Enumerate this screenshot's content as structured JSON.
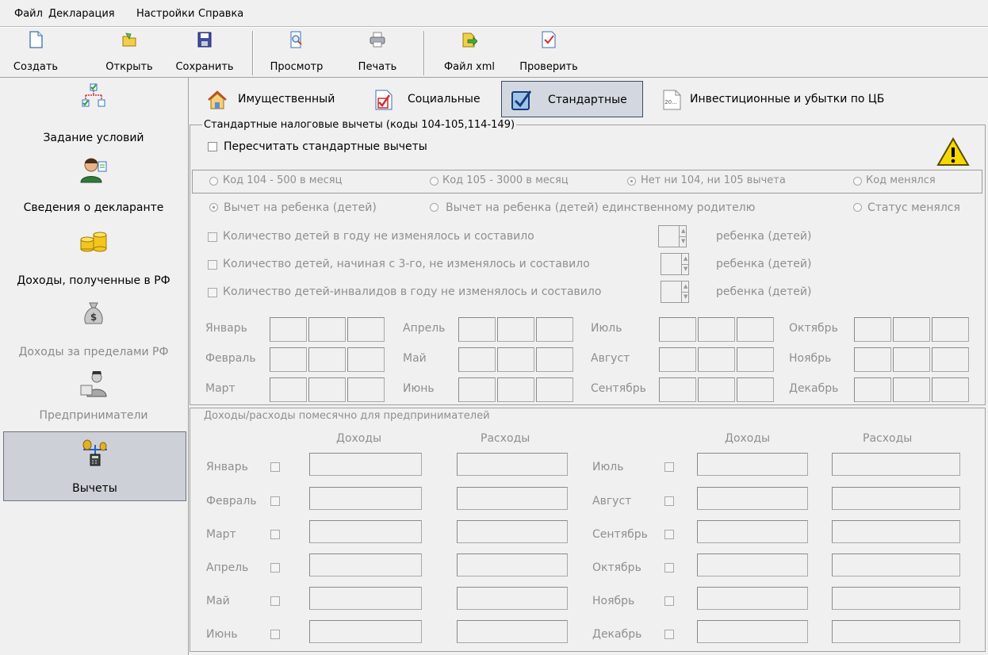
{
  "menu": [
    "Файл",
    "Декларация",
    "Настройки",
    "Справка"
  ],
  "toolbar": {
    "create": "Создать",
    "open": "Открыть",
    "save": "Сохранить",
    "preview": "Просмотр",
    "print": "Печать",
    "xml": "Файл xml",
    "check": "Проверить"
  },
  "sidebar": [
    {
      "label": "Задание условий",
      "icon": "conditions-icon",
      "state": "normal"
    },
    {
      "label": "Сведения о декларанте",
      "icon": "person-icon",
      "state": "normal"
    },
    {
      "label": "Доходы, полученные в РФ",
      "icon": "coins-icon",
      "state": "normal"
    },
    {
      "label": "Доходы за пределами РФ",
      "icon": "money-bag-icon",
      "state": "disabled"
    },
    {
      "label": "Предприниматели",
      "icon": "businessman-icon",
      "state": "disabled"
    },
    {
      "label": "Вычеты",
      "icon": "calculator-icon",
      "state": "selected"
    }
  ],
  "tabs": [
    {
      "label": "Имущественный",
      "icon": "house-icon"
    },
    {
      "label": "Социальные",
      "icon": "checked-doc-icon"
    },
    {
      "label": "Стандартные",
      "icon": "checkbox-icon",
      "active": true
    },
    {
      "label": "Инвестиционные и убытки по ЦБ",
      "icon": "doc-20-icon",
      "icon_text": "20..."
    }
  ],
  "standard": {
    "title": "Стандартные налоговые вычеты (коды 104-105,114-149)",
    "recalc": "Пересчитать стандартные вычеты",
    "codes": {
      "code104": "Код 104 - 500 в месяц",
      "code105": "Код 105 - 3000 в месяц",
      "none": "Нет ни 104, ни 105 вычета",
      "changed": "Код менялся",
      "selected": "none"
    },
    "child": {
      "child": "Вычет на ребенка (детей)",
      "single_parent": "Вычет на ребенка (детей) единственному родителю",
      "status": "Статус менялся",
      "selected": "child"
    },
    "counts": [
      {
        "label": "Количество детей в году не изменялось и составило",
        "unit": "ребенка (детей)"
      },
      {
        "label": "Количество детей, начиная с 3-го, не изменялось и составило",
        "unit": "ребенка (детей)"
      },
      {
        "label": "Количество детей-инвалидов в году не изменялось и составило",
        "unit": "ребенка (детей)"
      }
    ],
    "months": [
      "Январь",
      "Февраль",
      "Март",
      "Апрель",
      "Май",
      "Июнь",
      "Июль",
      "Август",
      "Сентябрь",
      "Октябрь",
      "Ноябрь",
      "Декабрь"
    ]
  },
  "entrepreneur": {
    "title": "Доходы/расходы помесячно для предпринимателей",
    "income": "Доходы",
    "expense": "Расходы",
    "left_months": [
      "Январь",
      "Февраль",
      "Март",
      "Апрель",
      "Май",
      "Июнь"
    ],
    "right_months": [
      "Июль",
      "Август",
      "Сентябрь",
      "Октябрь",
      "Ноябрь",
      "Декабрь"
    ]
  },
  "colors": {
    "accent": "#d3d8e0",
    "selected_border": "#3b4a66",
    "disabled_text": "#8f8f8f",
    "warning": "#f5d800"
  }
}
